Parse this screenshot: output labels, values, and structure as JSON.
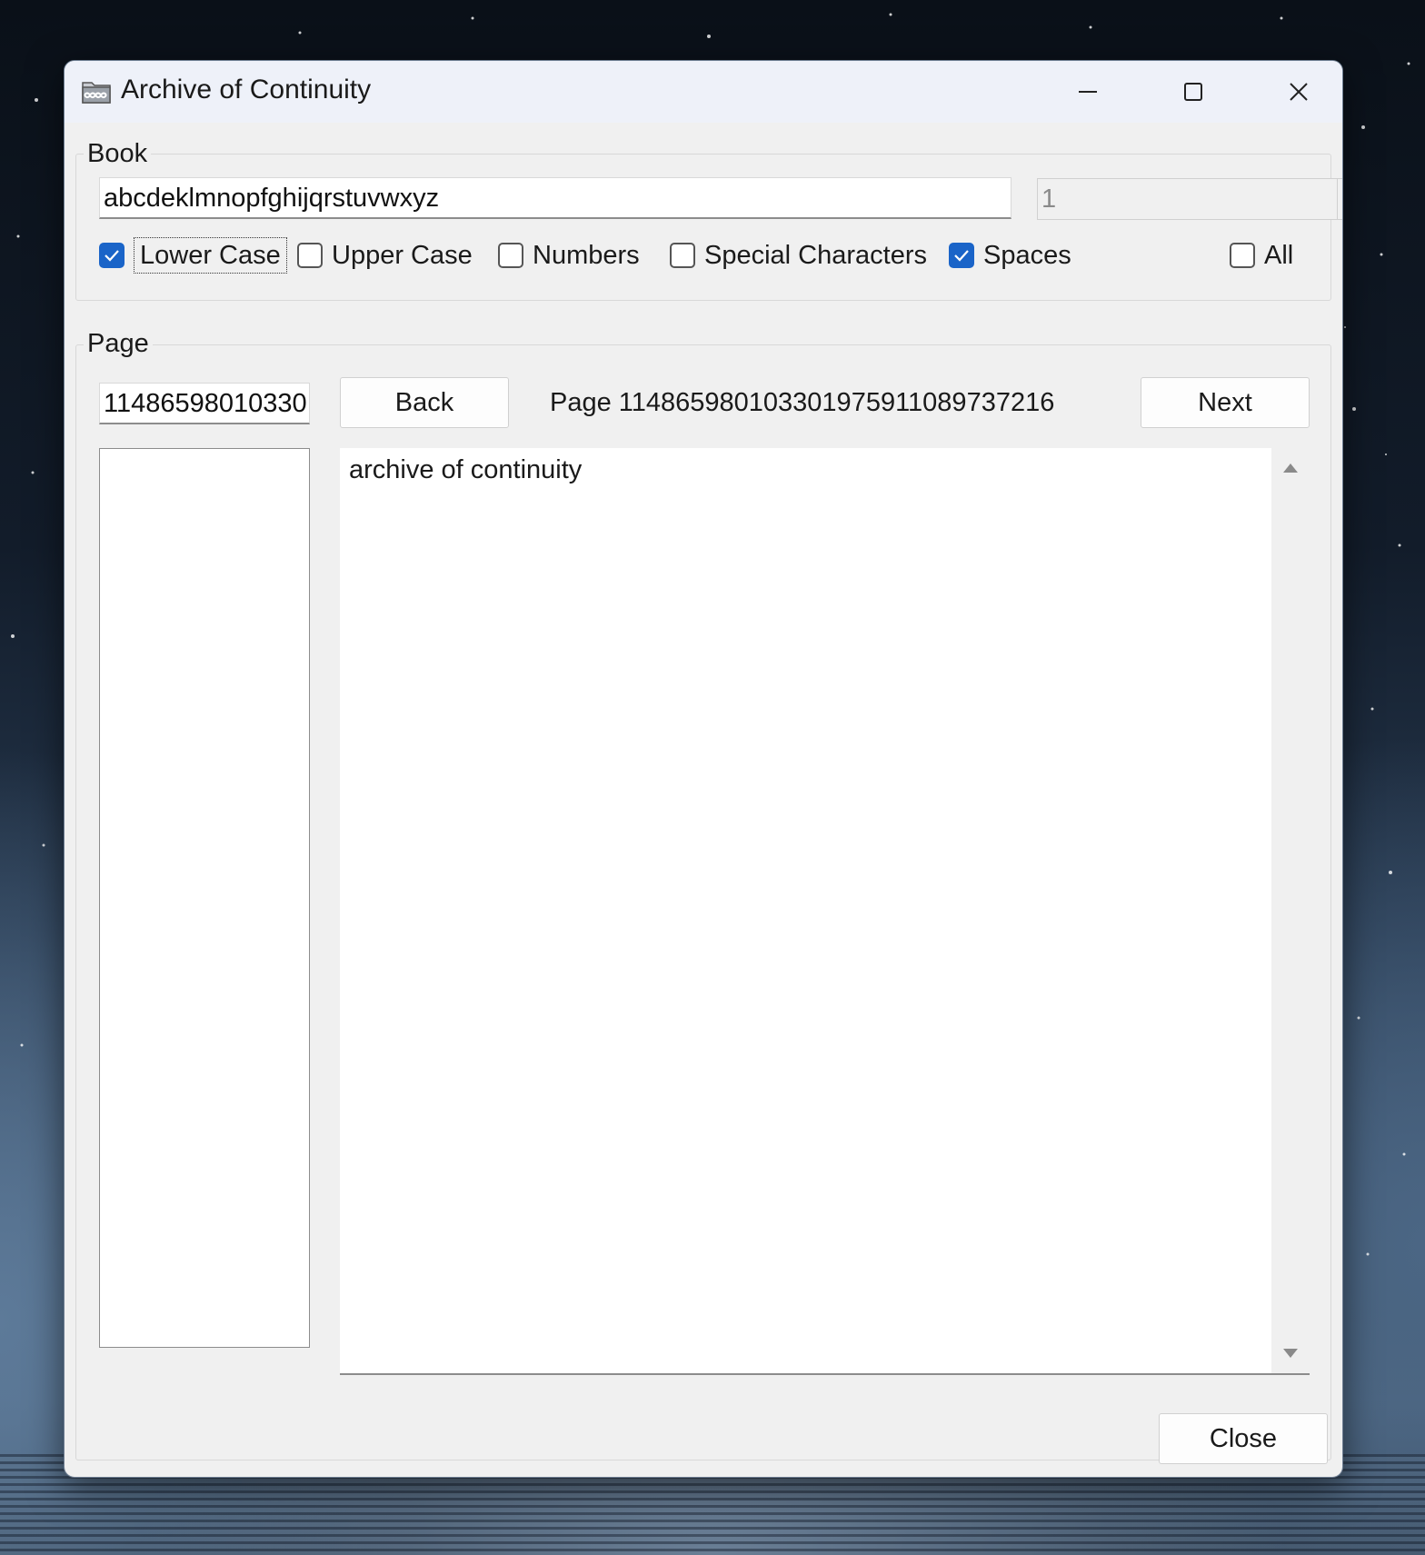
{
  "window": {
    "title": "Archive of Continuity",
    "app_icon": "archive-infinity-icon",
    "controls": [
      "minimize-icon",
      "maximize-icon",
      "close-icon"
    ]
  },
  "book": {
    "group_label": "Book",
    "text_value": "abcdeklmnopfghijqrstuvwxyz",
    "spin_value": "1",
    "checkboxes": [
      {
        "label": "Lower Case",
        "checked": true
      },
      {
        "label": "Upper Case",
        "checked": false
      },
      {
        "label": "Numbers",
        "checked": false
      },
      {
        "label": "Special Characters",
        "checked": false
      },
      {
        "label": "Spaces",
        "checked": true
      },
      {
        "label": "All",
        "checked": false
      }
    ]
  },
  "page": {
    "group_label": "Page",
    "page_input_value": "11486598010330",
    "back_label": "Back",
    "page_display": "Page 1148659801033019759110897372​16",
    "next_label": "Next",
    "content": "archive of continuity"
  },
  "footer": {
    "close_label": "Close"
  },
  "colors": {
    "accent": "#1a64c8",
    "window_bg": "#f0f0f0",
    "titlebar_bg": "#eef1f9"
  }
}
